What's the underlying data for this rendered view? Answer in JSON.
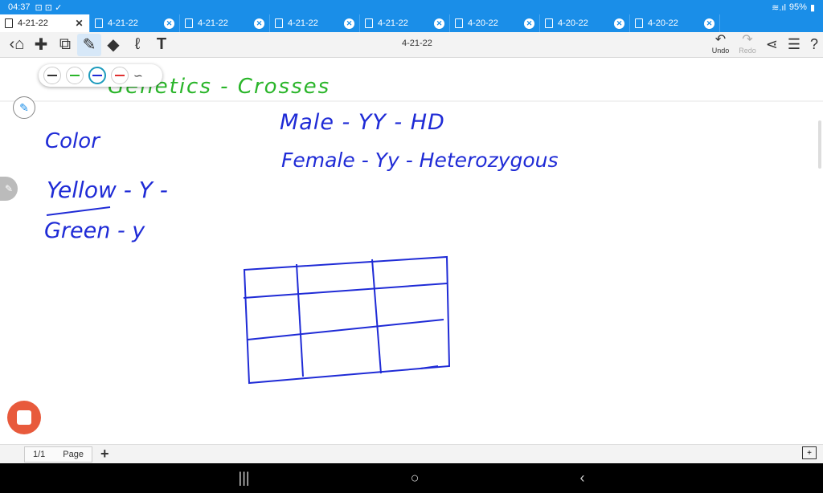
{
  "statusbar": {
    "time": "04:37",
    "icons_left": "⊡ ⊡ ✓",
    "signal": "≋.ıl",
    "battery": "95%"
  },
  "tabs": [
    {
      "label": "4-21-22"
    },
    {
      "label": "4-21-22"
    },
    {
      "label": "4-21-22"
    },
    {
      "label": "4-21-22"
    },
    {
      "label": "4-21-22"
    },
    {
      "label": "4-20-22"
    },
    {
      "label": "4-20-22"
    },
    {
      "label": "4-20-22"
    }
  ],
  "toolbar": {
    "title": "4-21-22",
    "undo_label": "Undo",
    "redo_label": "Redo"
  },
  "pagebar": {
    "page_count": "1/1",
    "page_label": "Page"
  },
  "ink": {
    "title": "Genetics - Crosses",
    "color_label": "Color",
    "yellow": "Yellow - Y -",
    "green": "Green - y",
    "male": "Male - YY - HD",
    "female": "Female - Yy - Heterozygous"
  },
  "colors": {
    "tabbar": "#1a8ee8",
    "ink_blue": "#1f2bd6",
    "ink_green": "#2ab52a"
  }
}
